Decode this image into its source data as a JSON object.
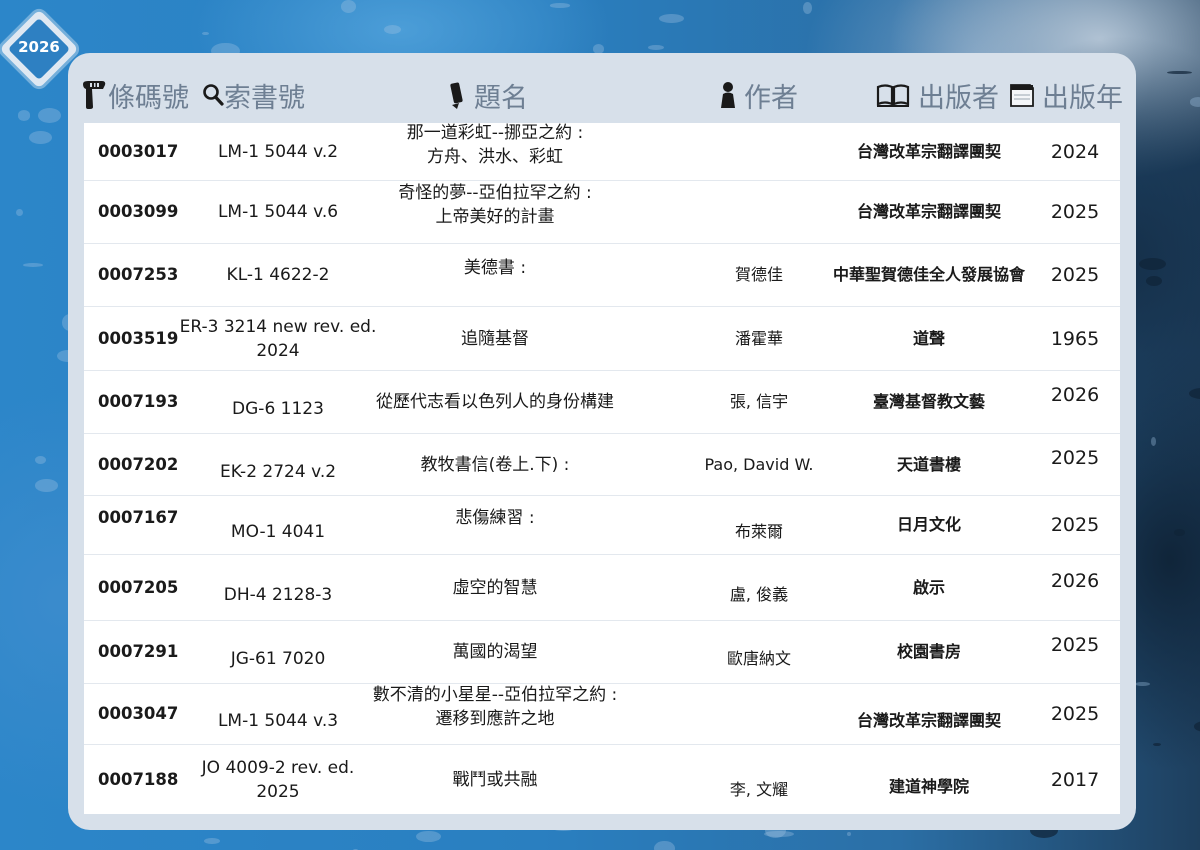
{
  "badge": {
    "year": "2026"
  },
  "header": {
    "barcode": "條碼號",
    "call_number": "索書號",
    "title": "題名",
    "author": "作者",
    "publisher": "出版者",
    "year": "出版年"
  },
  "rows": [
    {
      "barcode": "0003017",
      "call": [
        "LM-1 5044 v.2"
      ],
      "title": [
        "那一道彩虹--挪亞之約 :",
        "方舟、洪水、彩虹"
      ],
      "author": "",
      "publisher": "台灣改革宗翻譯團契",
      "year": "2024"
    },
    {
      "barcode": "0003099",
      "call": [
        "LM-1 5044 v.6"
      ],
      "title": [
        "奇怪的夢--亞伯拉罕之約 :",
        "上帝美好的計畫"
      ],
      "author": "",
      "publisher": "台灣改革宗翻譯團契",
      "year": "2025"
    },
    {
      "barcode": "0007253",
      "call": [
        "KL-1 4622-2"
      ],
      "title": [
        "美德書 :"
      ],
      "author": "賀德佳",
      "publisher": "中華聖賀德佳全人發展協會",
      "year": "2025"
    },
    {
      "barcode": "0003519",
      "call": [
        "ER-3 3214 new rev. ed.",
        "2024"
      ],
      "title": [
        "追隨基督"
      ],
      "author": "潘霍華",
      "publisher": "道聲",
      "year": "1965"
    },
    {
      "barcode": "0007193",
      "call": [
        "DG-6 1123"
      ],
      "title": [
        "從歷代志看以色列人的身份構建"
      ],
      "author": "張, 信宇",
      "publisher": "臺灣基督教文藝",
      "year": "2026"
    },
    {
      "barcode": "0007202",
      "call": [
        "EK-2 2724 v.2"
      ],
      "title": [
        "教牧書信(卷上.下) :"
      ],
      "author": "Pao, David W.",
      "publisher": "天道書樓",
      "year": "2025"
    },
    {
      "barcode": "0007167",
      "call": [
        "MO-1 4041"
      ],
      "title": [
        "悲傷練習 :"
      ],
      "author": "布萊爾",
      "publisher": "日月文化",
      "year": "2025"
    },
    {
      "barcode": "0007205",
      "call": [
        "DH-4 2128-3"
      ],
      "title": [
        "虛空的智慧"
      ],
      "author": "盧, 俊義",
      "publisher": "啟示",
      "year": "2026"
    },
    {
      "barcode": "0007291",
      "call": [
        "JG-61 7020"
      ],
      "title": [
        "萬國的渴望"
      ],
      "author": "歐唐納文",
      "publisher": "校園書房",
      "year": "2025"
    },
    {
      "barcode": "0003047",
      "call": [
        "LM-1 5044 v.3"
      ],
      "title": [
        "數不清的小星星--亞伯拉罕之約 :",
        "遷移到應許之地"
      ],
      "author": "",
      "publisher": "台灣改革宗翻譯團契",
      "year": "2025"
    },
    {
      "barcode": "0007188",
      "call": [
        "JO 4009-2 rev. ed.",
        "2025"
      ],
      "title": [
        "戰鬥或共融"
      ],
      "author": "李, 文耀",
      "publisher": "建道神學院",
      "year": "2017"
    }
  ]
}
